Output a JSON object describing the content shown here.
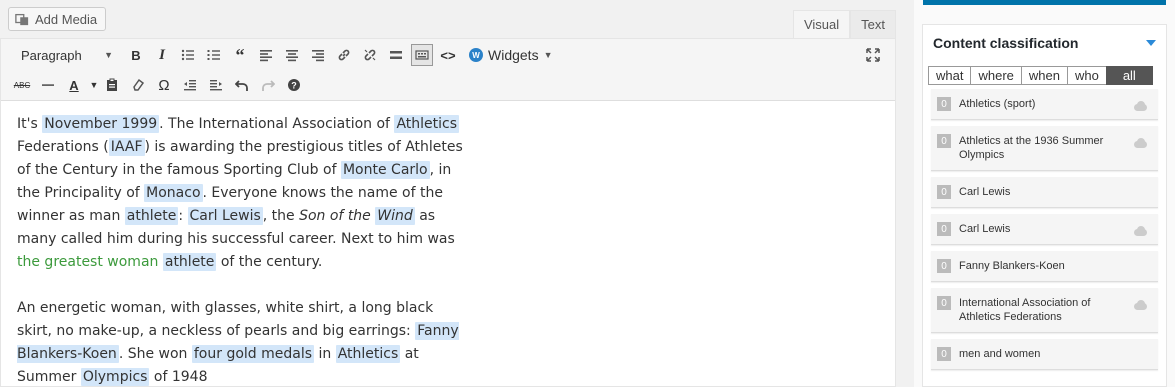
{
  "editor": {
    "add_media_label": "Add Media",
    "tabs": [
      {
        "label": "Visual",
        "active": true
      },
      {
        "label": "Text",
        "active": false
      }
    ],
    "toolbar": {
      "format_select": "Paragraph",
      "widgets_label": "Widgets",
      "row1_icons": [
        "bold-icon",
        "italic-icon",
        "bulleted-list-icon",
        "numbered-list-icon",
        "blockquote-icon",
        "align-left-icon",
        "align-center-icon",
        "align-right-icon",
        "link-icon",
        "unlink-icon",
        "read-more-icon",
        "toolbar-toggle-icon",
        "code-icon"
      ],
      "row2_icons": [
        "strikethrough-icon",
        "horizontal-line-icon",
        "text-color-icon",
        "paste-as-text-icon",
        "clear-formatting-icon",
        "special-character-icon",
        "outdent-icon",
        "indent-icon",
        "undo-icon",
        "redo-icon",
        "help-icon"
      ]
    },
    "content": {
      "p1": [
        {
          "t": "It's ",
          "s": "plain"
        },
        {
          "t": "November 1999",
          "s": "ent"
        },
        {
          "t": ". The International Association of ",
          "s": "plain"
        },
        {
          "t": "Athletics",
          "s": "ent"
        },
        {
          "t": " Federations (",
          "s": "plain"
        },
        {
          "t": "IAAF",
          "s": "ent"
        },
        {
          "t": ") is awarding the prestigious titles of Athletes of the Century in the famous Sporting Club of ",
          "s": "plain"
        },
        {
          "t": "Monte Carlo",
          "s": "ent"
        },
        {
          "t": ", in the Principality of ",
          "s": "plain"
        },
        {
          "t": "Monaco",
          "s": "ent"
        },
        {
          "t": ". Everyone knows the name of the winner as man ",
          "s": "plain"
        },
        {
          "t": "athlete",
          "s": "ent"
        },
        {
          "t": ": ",
          "s": "plain"
        },
        {
          "t": "Carl Lewis",
          "s": "ent"
        },
        {
          "t": ", the ",
          "s": "plain"
        },
        {
          "t": "Son of the ",
          "s": "it"
        },
        {
          "t": "Wind",
          "s": "ent-it"
        },
        {
          "t": " as many called him during his successful career. Next to him was ",
          "s": "plain"
        },
        {
          "t": "the greatest woman",
          "s": "green"
        },
        {
          "t": " ",
          "s": "plain"
        },
        {
          "t": "athlete",
          "s": "ent"
        },
        {
          "t": " of the century.",
          "s": "plain"
        }
      ],
      "p2": [
        {
          "t": "An energetic woman, with glasses, white shirt, a long black skirt, no make-up, a neckless of pearls and big earrings: ",
          "s": "plain"
        },
        {
          "t": "Fanny Blankers-Koen",
          "s": "ent"
        },
        {
          "t": ". She won ",
          "s": "plain"
        },
        {
          "t": "four gold medals",
          "s": "ent"
        },
        {
          "t": " in ",
          "s": "plain"
        },
        {
          "t": "Athletics",
          "s": "ent"
        },
        {
          "t": " at Summer ",
          "s": "plain"
        },
        {
          "t": "Olympics",
          "s": "ent"
        },
        {
          "t": " of 1948",
          "s": "plain"
        }
      ]
    }
  },
  "sidebar": {
    "panel_title": "Content classification",
    "filters": [
      {
        "label": "what",
        "active": false
      },
      {
        "label": "where",
        "active": false
      },
      {
        "label": "when",
        "active": false
      },
      {
        "label": "who",
        "active": false
      },
      {
        "label": "all",
        "active": true
      }
    ],
    "items": [
      {
        "count": "0",
        "label": "Athletics (sport)",
        "cloud": true
      },
      {
        "count": "0",
        "label": "Athletics at the 1936 Summer Olympics",
        "cloud": true
      },
      {
        "count": "0",
        "label": "Carl Lewis",
        "cloud": false
      },
      {
        "count": "0",
        "label": "Carl Lewis",
        "cloud": true
      },
      {
        "count": "0",
        "label": "Fanny Blankers-Koen",
        "cloud": false
      },
      {
        "count": "0",
        "label": "International Association of Athletics Federations",
        "cloud": true
      },
      {
        "count": "0",
        "label": "men and women",
        "cloud": false
      }
    ]
  },
  "colors": {
    "entity_highlight": "#d3e6f9",
    "green_text": "#3c9a3c",
    "accent_blue": "#0073aa"
  }
}
